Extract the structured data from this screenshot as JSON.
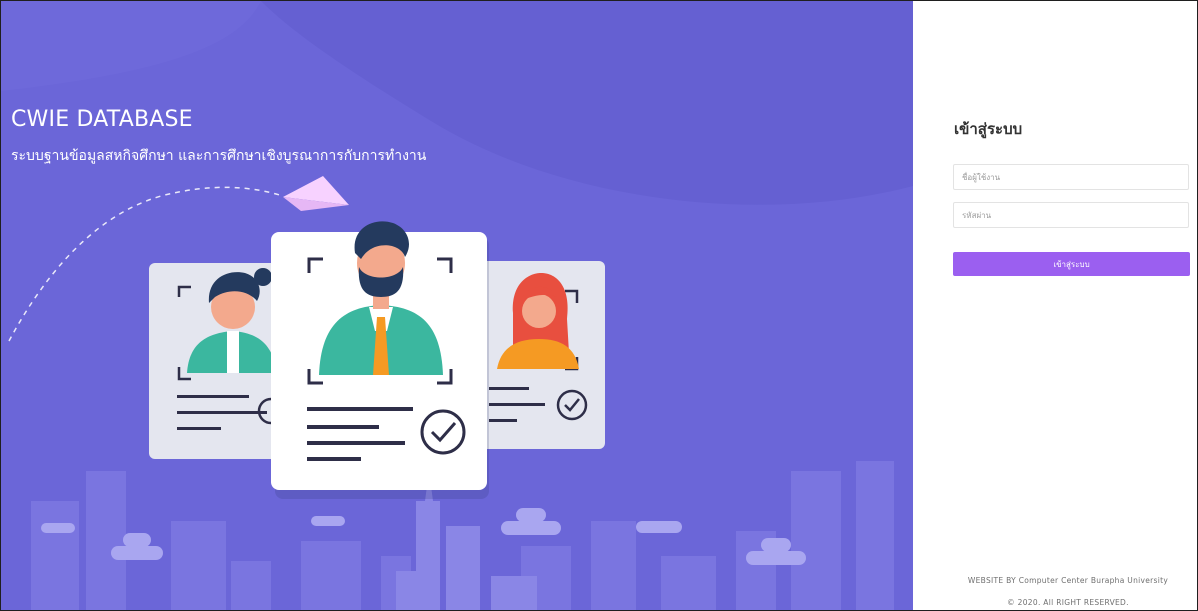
{
  "hero": {
    "title": "CWIE DATABASE",
    "subtitle": "ระบบฐานข้อมูลสหกิจศึกษา และการศึกษาเชิงบูรณาการกับการทำงาน",
    "background_color": "#6b66d8",
    "illustration_icons": [
      "paper-plane-icon",
      "profile-card-icon",
      "check-circle-icon",
      "city-skyline"
    ]
  },
  "login": {
    "heading": "เข้าสู่ระบบ",
    "username_placeholder": "ชื่อผู้ใช้งาน",
    "password_placeholder": "รหัสผ่าน",
    "submit_label": "เข้าสู่ระบบ",
    "button_color": "#9b5ff0"
  },
  "footer": {
    "credit": "WEBSITE BY Computer Center Burapha University",
    "copyright": "© 2020. All RIGHT RESERVED."
  }
}
